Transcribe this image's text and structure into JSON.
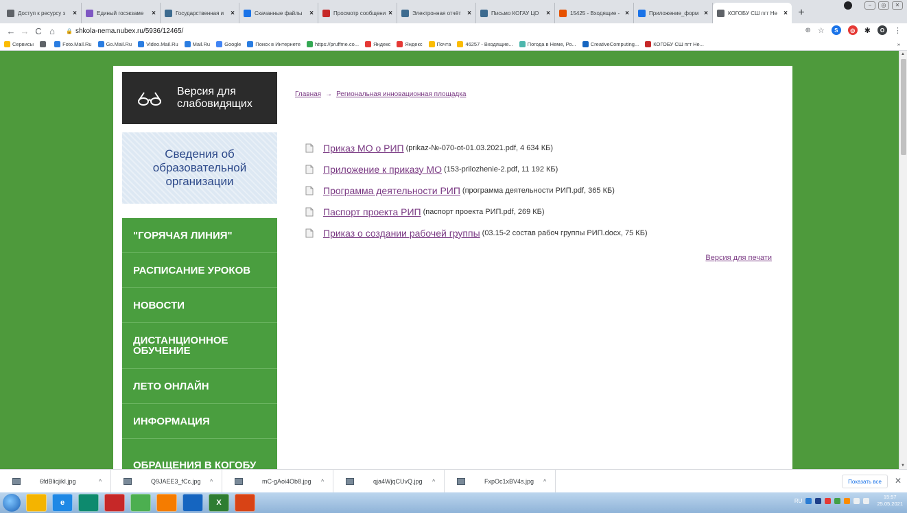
{
  "browser": {
    "tabs": [
      {
        "title": "Доступ к ресурсу з",
        "color": "#5f6368"
      },
      {
        "title": "Единый госэкзаме",
        "color": "#7e57c2"
      },
      {
        "title": "Государственная и",
        "color": "#3d6b8f"
      },
      {
        "title": "Скачанные файлы",
        "color": "#1a73e8"
      },
      {
        "title": "Просмотр сообщени",
        "color": "#c62828"
      },
      {
        "title": "Электронная отчёт",
        "color": "#3d6b8f"
      },
      {
        "title": "Письмо КОГАУ ЦО",
        "color": "#3d6b8f"
      },
      {
        "title": "15425 - Входящие -",
        "color": "#e65100"
      },
      {
        "title": "Приложение_форм",
        "color": "#1a73e8"
      },
      {
        "title": "КОГОБУ СШ пгт Не",
        "color": "#5f6368",
        "active": true
      }
    ],
    "new_tab": "+",
    "url": "shkola-nema.nubex.ru/5936/12465/",
    "bookmarks": [
      {
        "label": "Сервисы",
        "color": "#fbbc04"
      },
      {
        "label": "",
        "color": "#5f6368"
      },
      {
        "label": "Foto.Mail.Ru",
        "color": "#2a7de1"
      },
      {
        "label": "Go.Mail.Ru",
        "color": "#2a7de1"
      },
      {
        "label": "Video.Mail.Ru",
        "color": "#2a7de1"
      },
      {
        "label": "Mail.Ru",
        "color": "#2a7de1"
      },
      {
        "label": "Google",
        "color": "#4285f4"
      },
      {
        "label": "Поиск в Интернете",
        "color": "#2a7de1"
      },
      {
        "label": "https://pruffme.co...",
        "color": "#34a853"
      },
      {
        "label": "Яндекс",
        "color": "#e53935"
      },
      {
        "label": "Яндекс",
        "color": "#e53935"
      },
      {
        "label": "Почта",
        "color": "#fbbc04"
      },
      {
        "label": "46257 - Входящие...",
        "color": "#fbbc04"
      },
      {
        "label": "Погода в Неме, Ро...",
        "color": "#4db6ac"
      },
      {
        "label": "CreativeComputing...",
        "color": "#1565c0"
      },
      {
        "label": "КОГОБУ СШ пгт Не...",
        "color": "#c62828"
      }
    ],
    "bookmarks_more": "»"
  },
  "site": {
    "vision_label": "Версия для слабовидящих",
    "info_box": "Сведения об образовательной организации",
    "menu": [
      {
        "label": "\"ГОРЯЧАЯ ЛИНИЯ\""
      },
      {
        "label": "РАСПИСАНИЕ УРОКОВ"
      },
      {
        "label": "НОВОСТИ"
      },
      {
        "label": "ДИСТАНЦИОННОЕ ОБУЧЕНИЕ"
      },
      {
        "label": "ЛЕТО ОНЛАЙН"
      },
      {
        "label": "ИНФОРМАЦИЯ"
      },
      {
        "label": "ОБРАЩЕНИЯ В КОГОБУ"
      }
    ],
    "breadcrumb": {
      "home": "Главная",
      "arrow": "→",
      "current": "Региональная инновационная площадка"
    },
    "documents": [
      {
        "title": "Приказ МО о РИП",
        "meta": "(prikaz-№-070-ot-01.03.2021.pdf, 4 634 КБ)"
      },
      {
        "title": "Приложение к приказу МО",
        "meta": "(153-prilozhenie-2.pdf, 11 192 КБ)"
      },
      {
        "title": "Программа деятельности РИП",
        "meta": "(программа деятельности РИП.pdf, 365 КБ)"
      },
      {
        "title": "Паспорт проекта РИП",
        "meta": "(паспорт проекта РИП.pdf, 269 КБ)"
      },
      {
        "title": "Приказ о создании рабочей группы",
        "meta": "(03.15-2 состав рабоч группы РИП.docx, 75 КБ)"
      }
    ],
    "print_link": "Версия для печати"
  },
  "downloads": {
    "files": [
      "6fdBlicjikI.jpg",
      "Q9JAEE3_fCc.jpg",
      "mC-gAoi4Ob8.jpg",
      "qja4WjqCUvQ.jpg",
      "FxpOc1xBV4s.jpg"
    ],
    "show_all": "Показать все"
  },
  "taskbar": {
    "apps": [
      {
        "label": "",
        "color": "#f4b400"
      },
      {
        "label": "e",
        "color": "#1e88e5"
      },
      {
        "label": "",
        "color": "#0d8a6e"
      },
      {
        "label": "",
        "color": "#c62828"
      },
      {
        "label": "",
        "color": "#4caf50"
      },
      {
        "label": "",
        "color": "#f57c00"
      },
      {
        "label": "",
        "color": "#1565c0"
      },
      {
        "label": "X",
        "color": "#2e7d32"
      },
      {
        "label": "",
        "color": "#d84315"
      }
    ],
    "lang": "RU",
    "time": "15:57",
    "date": "25.05.2021"
  }
}
